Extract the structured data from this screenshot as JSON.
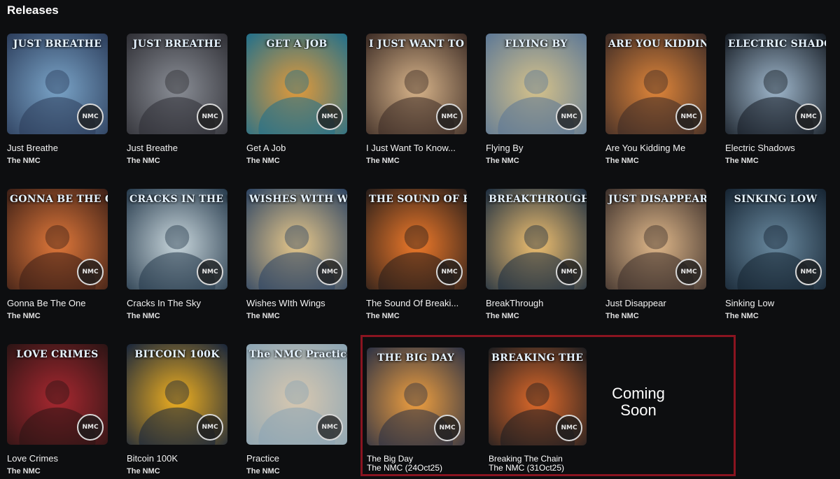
{
  "page": {
    "title": "Releases"
  },
  "releases": [
    {
      "name": "Just Breathe",
      "artist": "The NMC",
      "cover_text": "JUST BREATHE",
      "colors": [
        "#2b3c5a",
        "#7aa4c8"
      ]
    },
    {
      "name": "Just Breathe",
      "artist": "The NMC",
      "cover_text": "JUST BREATHE",
      "colors": [
        "#2e2e34",
        "#8a8e96"
      ]
    },
    {
      "name": "Get A Job",
      "artist": "The NMC",
      "cover_text": "GET A JOB",
      "colors": [
        "#1f6f8c",
        "#e29a3a"
      ]
    },
    {
      "name": "I Just Want To Know...",
      "artist": "The NMC",
      "cover_text": "I JUST WANT TO KNOW YOU",
      "colors": [
        "#3a2a24",
        "#d8b48a"
      ]
    },
    {
      "name": "Flying By",
      "artist": "The NMC",
      "cover_text": "FLYING BY",
      "colors": [
        "#5b7796",
        "#d6c28a"
      ]
    },
    {
      "name": "Are You Kidding Me",
      "artist": "The NMC",
      "cover_text": "ARE YOU KIDDING ME",
      "colors": [
        "#3b2a26",
        "#e0863a"
      ]
    },
    {
      "name": "Electric Shadows",
      "artist": "The NMC",
      "cover_text": "ELECTRIC SHADOWS",
      "colors": [
        "#141a22",
        "#9fb7cc"
      ]
    },
    {
      "name": "Gonna Be The One",
      "artist": "The NMC",
      "cover_text": "GONNA BE THE ONE",
      "colors": [
        "#3a1e16",
        "#e0783a"
      ]
    },
    {
      "name": "Cracks In The Sky",
      "artist": "The NMC",
      "cover_text": "CRACKS IN THE SKY",
      "colors": [
        "#24384a",
        "#c8d6dc"
      ]
    },
    {
      "name": "Wishes WIth Wings",
      "artist": "The NMC",
      "cover_text": "WISHES WITH WINGS",
      "colors": [
        "#2a4262",
        "#e8c88a"
      ]
    },
    {
      "name": "The Sound Of Breaki...",
      "artist": "The NMC",
      "cover_text": "THE SOUND OF BREAKING FREE",
      "colors": [
        "#241c1a",
        "#f07a2a"
      ]
    },
    {
      "name": "BreakThrough",
      "artist": "The NMC",
      "cover_text": "BREAKTHROUGH",
      "colors": [
        "#1a2c40",
        "#f0c070"
      ]
    },
    {
      "name": "Just Disappear",
      "artist": "The NMC",
      "cover_text": "JUST DISAPPEAR",
      "colors": [
        "#3a2e2a",
        "#e0b88a"
      ]
    },
    {
      "name": "Sinking Low",
      "artist": "The NMC",
      "cover_text": "SINKING LOW",
      "colors": [
        "#142230",
        "#6a8aa0"
      ]
    },
    {
      "name": "Love Crimes",
      "artist": "The NMC",
      "cover_text": "LOVE CRIMES",
      "colors": [
        "#2a1414",
        "#a82830"
      ]
    },
    {
      "name": "Bitcoin 100K",
      "artist": "The NMC",
      "cover_text": "BITCOIN 100K",
      "colors": [
        "#16243c",
        "#f0b020"
      ]
    },
    {
      "name": "Practice",
      "artist": "The NMC",
      "cover_text": "The NMC Practice",
      "colors": [
        "#8aa4b4",
        "#d8c8b0"
      ]
    }
  ],
  "coming_soon": {
    "label": "Coming Soon",
    "items": [
      {
        "name": "The Big Day",
        "artist_date": "The NMC (24Oct25)",
        "cover_text": "THE BIG DAY",
        "colors": [
          "#2a3044",
          "#f0a040"
        ]
      },
      {
        "name": "Breaking The Chain",
        "artist_date": "The NMC (31Oct25)",
        "cover_text": "BREAKING THE CHAINS",
        "colors": [
          "#1a1c20",
          "#e06a2a"
        ]
      }
    ]
  },
  "badge_text": "NMC",
  "accent_border": "#8a1420"
}
